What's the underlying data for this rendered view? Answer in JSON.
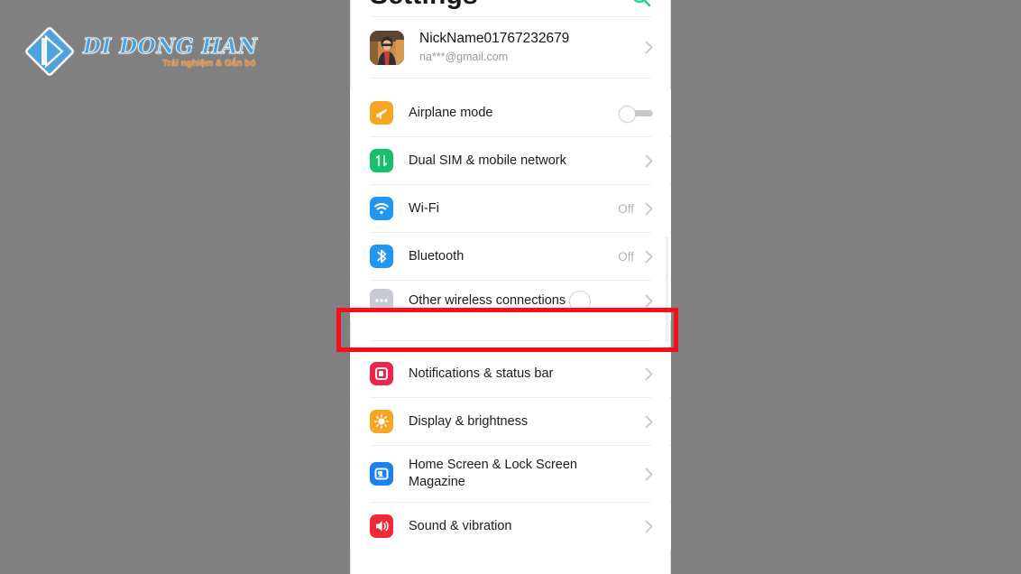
{
  "watermark": {
    "name": "di-dong-han-logo",
    "title": "DI DONG HAN",
    "tagline": "Trải nghiệm & Gắn bó",
    "diamond_color": "#4fa3dd",
    "title_color": "#4fa3dd",
    "tagline_color": "#f08a24"
  },
  "header": {
    "title": "Settings",
    "search_icon": "search-icon",
    "search_icon_color": "#1fd18a"
  },
  "account": {
    "avatar": "user-avatar-photo",
    "name": "NickName01767232679",
    "email": "na***@gmail.com",
    "chevron": "chevron-right-icon"
  },
  "groups": [
    {
      "name": "connectivity-group",
      "items": [
        {
          "id": "airplane-mode",
          "label": "Airplane mode",
          "icon": "airplane-icon",
          "icon_color": "#f5a623",
          "control": "toggle",
          "toggle_on": false,
          "value": ""
        },
        {
          "id": "dual-sim",
          "label": "Dual SIM & mobile network",
          "icon": "sim-transfer-icon",
          "icon_color": "#15c26b",
          "control": "chevron",
          "value": ""
        },
        {
          "id": "wifi",
          "label": "Wi-Fi",
          "icon": "wifi-icon",
          "icon_color": "#2196f3",
          "control": "chevron",
          "value": "Off"
        },
        {
          "id": "bluetooth",
          "label": "Bluetooth",
          "icon": "bluetooth-icon",
          "icon_color": "#2196f3",
          "control": "chevron",
          "value": "Off"
        },
        {
          "id": "other-wireless",
          "label": "Other wireless connections",
          "icon": "ellipsis-icon",
          "icon_color": "#c7c9d3",
          "control": "chevron",
          "value": "",
          "highlighted": true
        }
      ]
    },
    {
      "name": "device-group",
      "items": [
        {
          "id": "notifications",
          "label": "Notifications & status bar",
          "icon": "notifications-icon",
          "icon_color": "#f0234b",
          "control": "chevron",
          "value": ""
        },
        {
          "id": "display",
          "label": "Display & brightness",
          "icon": "brightness-icon",
          "icon_color": "#f5a623",
          "control": "chevron",
          "value": ""
        },
        {
          "id": "home-lock-screen",
          "label": "Home Screen & Lock Screen Magazine",
          "icon": "home-screen-icon",
          "icon_color": "#1a81f0",
          "control": "chevron",
          "value": ""
        },
        {
          "id": "sound",
          "label": "Sound & vibration",
          "icon": "speaker-icon",
          "icon_color": "#eb2b3a",
          "control": "chevron",
          "value": ""
        }
      ]
    }
  ],
  "annotation": {
    "name": "red-highlight-box",
    "color": "#fc0d1b",
    "targets": "other-wireless"
  }
}
